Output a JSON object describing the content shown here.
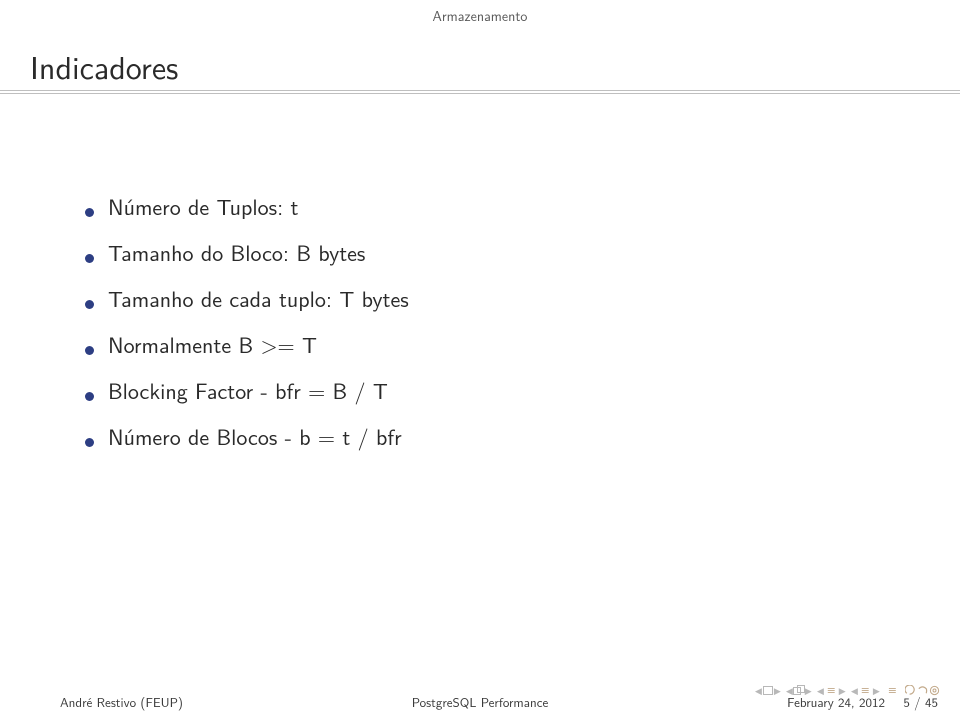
{
  "section": "Armazenamento",
  "title": "Indicadores",
  "items": [
    "Número de Tuplos: t",
    "Tamanho do Bloco: B bytes",
    "Tamanho de cada tuplo: T bytes",
    "Normalmente B >= T",
    "Blocking Factor - bfr = B / T",
    "Número de Blocos - b = t / bfr"
  ],
  "footer": {
    "author": "André Restivo (FEUP)",
    "talk": "PostgreSQL Performance",
    "date": "February 24, 2012",
    "page": "5 / 45"
  }
}
